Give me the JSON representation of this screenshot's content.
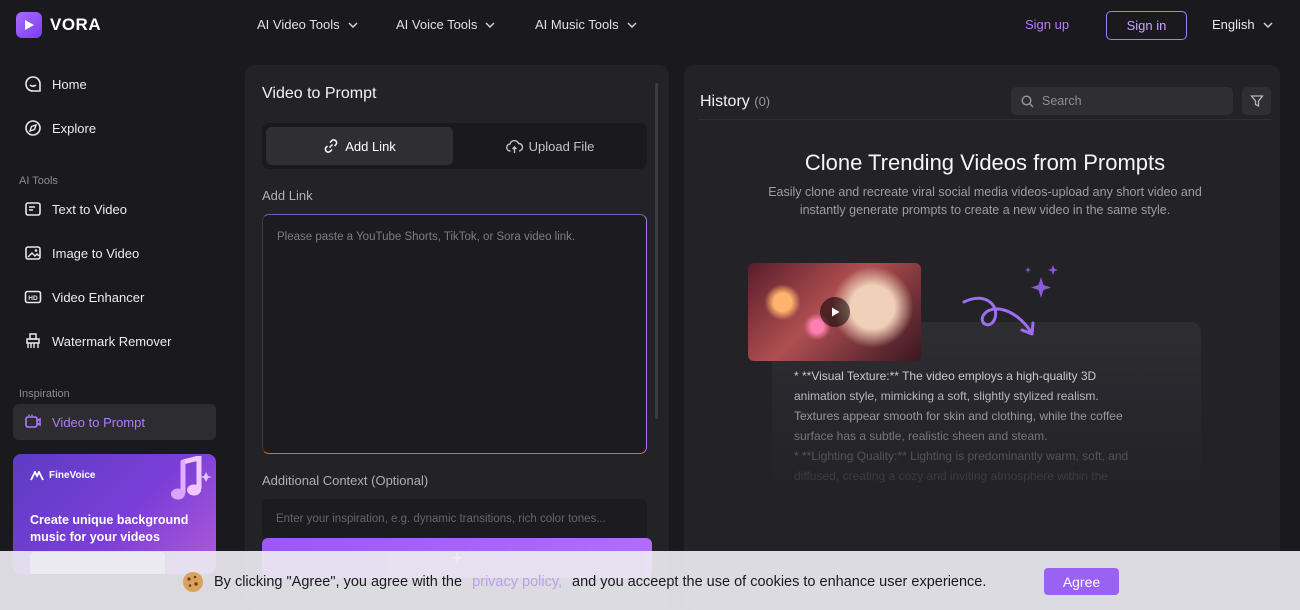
{
  "app": {
    "brand": "VORA"
  },
  "nav": {
    "items": [
      {
        "label": "AI Video Tools"
      },
      {
        "label": "AI Voice Tools"
      },
      {
        "label": "AI Music Tools"
      }
    ],
    "sign_up": "Sign up",
    "sign_in": "Sign in",
    "language": "English"
  },
  "sidebar": {
    "home": "Home",
    "explore": "Explore",
    "ai_tools_section": "AI Tools",
    "text_to_video": "Text to Video",
    "image_to_video": "Image to Video",
    "video_enhancer": "Video Enhancer",
    "watermark_remover": "Watermark Remover",
    "inspiration_section": "Inspiration",
    "video_to_prompt": "Video to Prompt",
    "promo": {
      "brand": "FineVoice",
      "text": "Create unique background music for your videos"
    }
  },
  "main": {
    "title": "Video to Prompt",
    "tabs": [
      {
        "label": "Add Link",
        "active": true
      },
      {
        "label": "Upload File",
        "active": false
      }
    ],
    "add_link_label": "Add Link",
    "link_placeholder": "Please paste a YouTube Shorts, TikTok, or Sora video link.",
    "context_label": "Additional Context (Optional)",
    "context_placeholder": "Enter your inspiration, e.g. dynamic transitions, rich color tones..."
  },
  "history": {
    "title": "History",
    "count": "(0)",
    "search_placeholder": "Search",
    "hero_title": "Clone Trending Videos from Prompts",
    "hero_desc": "Easily clone and recreate viral social media videos-upload any short video and instantly generate prompts to create a new video in the same style.",
    "prompt_lines": [
      "*   **Visual Texture:** The video employs a high-quality 3D",
      "animation style, mimicking a soft, slightly stylized realism.",
      "Textures appear smooth for skin and clothing, while the coffee",
      "surface has a subtle, realistic sheen and steam.",
      "*   **Lighting Quality:** Lighting is predominantly warm, soft, and",
      "diffused, creating a cozy and inviting atmosphere within the"
    ]
  },
  "cookie": {
    "text_before": "By clicking \"Agree\", you agree with the",
    "link": "privacy policy,",
    "text_after": "and you acceept the use of cookies to enhance user experience.",
    "agree": "Agree"
  },
  "colors": {
    "accent": "#a56cff",
    "background": "#1a191d",
    "panel": "#232226"
  }
}
